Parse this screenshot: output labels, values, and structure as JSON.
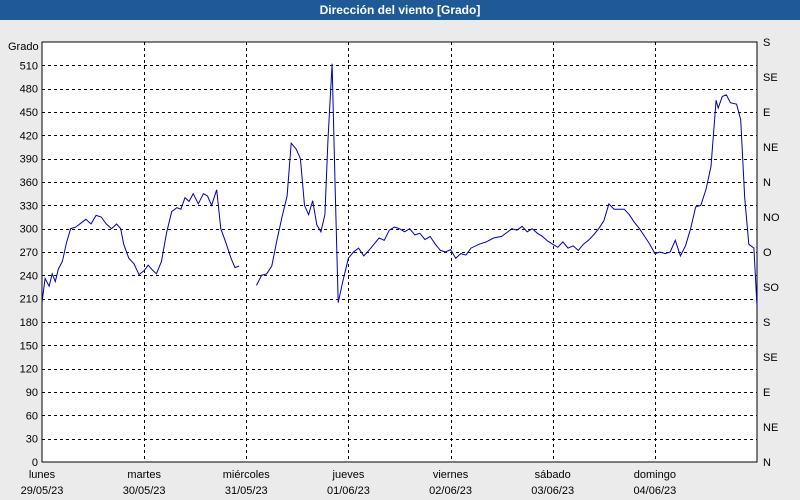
{
  "window": {
    "title": "Dirección del viento [Grado]"
  },
  "colors": {
    "title_bar": "#1f5a96",
    "line": "#0000b4",
    "plot_bg": "#ffffff",
    "window_bg": "#ebebeb",
    "grid": "#000000"
  },
  "chart_data": {
    "type": "line",
    "title": "Dirección del viento [Grado]",
    "ylabel": "Grado",
    "ylim": [
      0,
      540
    ],
    "yticks": [
      0,
      30,
      60,
      90,
      120,
      150,
      180,
      210,
      240,
      270,
      300,
      330,
      360,
      390,
      420,
      450,
      480,
      510
    ],
    "right_axis_ticks": [
      {
        "value": 0,
        "label": "N"
      },
      {
        "value": 45,
        "label": "NE"
      },
      {
        "value": 90,
        "label": "E"
      },
      {
        "value": 135,
        "label": "SE"
      },
      {
        "value": 180,
        "label": "S"
      },
      {
        "value": 225,
        "label": "SO"
      },
      {
        "value": 270,
        "label": "O"
      },
      {
        "value": 315,
        "label": "NO"
      },
      {
        "value": 360,
        "label": "N"
      },
      {
        "value": 405,
        "label": "NE"
      },
      {
        "value": 450,
        "label": "E"
      },
      {
        "value": 495,
        "label": "SE"
      },
      {
        "value": 540,
        "label": "S"
      }
    ],
    "xlim": [
      0,
      7
    ],
    "day_labels": [
      {
        "day": "lunes",
        "date": "29/05/23"
      },
      {
        "day": "martes",
        "date": "30/05/23"
      },
      {
        "day": "miércoles",
        "date": "31/05/23"
      },
      {
        "day": "jueves",
        "date": "01/06/23"
      },
      {
        "day": "viernes",
        "date": "02/06/23"
      },
      {
        "day": "sábado",
        "date": "03/06/23"
      },
      {
        "day": "domingo",
        "date": "04/06/23"
      }
    ],
    "grid": true,
    "series": [
      {
        "segments": [
          [
            [
              0.0,
              205
            ],
            [
              0.03,
              236
            ],
            [
              0.07,
              226
            ],
            [
              0.1,
              242
            ],
            [
              0.13,
              232
            ],
            [
              0.16,
              248
            ],
            [
              0.2,
              258
            ],
            [
              0.24,
              282
            ],
            [
              0.28,
              300
            ],
            [
              0.33,
              302
            ],
            [
              0.38,
              307
            ],
            [
              0.43,
              312
            ],
            [
              0.48,
              306
            ],
            [
              0.53,
              317
            ],
            [
              0.58,
              315
            ],
            [
              0.63,
              306
            ],
            [
              0.68,
              300
            ],
            [
              0.73,
              306
            ],
            [
              0.77,
              300
            ],
            [
              0.8,
              280
            ],
            [
              0.85,
              262
            ],
            [
              0.9,
              255
            ],
            [
              0.95,
              241
            ],
            [
              1.0,
              246
            ],
            [
              1.04,
              253
            ],
            [
              1.08,
              247
            ],
            [
              1.12,
              242
            ],
            [
              1.17,
              258
            ],
            [
              1.22,
              295
            ],
            [
              1.27,
              322
            ],
            [
              1.32,
              327
            ],
            [
              1.36,
              325
            ],
            [
              1.4,
              340
            ],
            [
              1.44,
              335
            ],
            [
              1.48,
              345
            ],
            [
              1.53,
              332
            ],
            [
              1.58,
              345
            ],
            [
              1.62,
              342
            ],
            [
              1.66,
              330
            ],
            [
              1.71,
              350
            ],
            [
              1.75,
              300
            ],
            [
              1.8,
              282
            ],
            [
              1.85,
              262
            ],
            [
              1.89,
              250
            ],
            [
              1.93,
              252
            ]
          ],
          [
            [
              2.1,
              227
            ],
            [
              2.15,
              240
            ],
            [
              2.2,
              242
            ],
            [
              2.25,
              252
            ],
            [
              2.3,
              285
            ],
            [
              2.35,
              315
            ],
            [
              2.4,
              342
            ],
            [
              2.44,
              410
            ],
            [
              2.49,
              402
            ],
            [
              2.53,
              390
            ],
            [
              2.57,
              330
            ],
            [
              2.61,
              318
            ],
            [
              2.65,
              336
            ],
            [
              2.69,
              305
            ],
            [
              2.73,
              296
            ],
            [
              2.77,
              318
            ],
            [
              2.8,
              415
            ],
            [
              2.84,
              512
            ],
            [
              2.87,
              350
            ],
            [
              2.9,
              205
            ],
            [
              2.95,
              235
            ],
            [
              3.0,
              262
            ],
            [
              3.05,
              270
            ],
            [
              3.1,
              275
            ],
            [
              3.15,
              265
            ],
            [
              3.2,
              272
            ],
            [
              3.25,
              280
            ],
            [
              3.3,
              288
            ],
            [
              3.35,
              285
            ],
            [
              3.4,
              298
            ],
            [
              3.45,
              302
            ],
            [
              3.5,
              300
            ],
            [
              3.55,
              296
            ],
            [
              3.6,
              300
            ],
            [
              3.65,
              292
            ],
            [
              3.7,
              294
            ],
            [
              3.75,
              286
            ],
            [
              3.8,
              290
            ],
            [
              3.85,
              280
            ],
            [
              3.9,
              272
            ],
            [
              3.95,
              270
            ],
            [
              4.0,
              273
            ],
            [
              4.05,
              262
            ],
            [
              4.1,
              268
            ],
            [
              4.15,
              266
            ],
            [
              4.2,
              275
            ],
            [
              4.28,
              280
            ],
            [
              4.35,
              283
            ],
            [
              4.42,
              288
            ],
            [
              4.5,
              290
            ],
            [
              4.55,
              295
            ],
            [
              4.6,
              300
            ],
            [
              4.65,
              298
            ],
            [
              4.7,
              303
            ],
            [
              4.75,
              296
            ],
            [
              4.8,
              300
            ],
            [
              4.85,
              294
            ],
            [
              4.9,
              290
            ],
            [
              4.95,
              284
            ],
            [
              5.0,
              280
            ],
            [
              5.05,
              276
            ],
            [
              5.1,
              283
            ],
            [
              5.15,
              275
            ],
            [
              5.2,
              278
            ],
            [
              5.25,
              272
            ],
            [
              5.3,
              280
            ],
            [
              5.35,
              285
            ],
            [
              5.4,
              292
            ],
            [
              5.45,
              300
            ],
            [
              5.5,
              310
            ],
            [
              5.55,
              332
            ],
            [
              5.6,
              325
            ],
            [
              5.65,
              325
            ],
            [
              5.7,
              325
            ],
            [
              5.75,
              318
            ],
            [
              5.8,
              308
            ],
            [
              5.85,
              300
            ],
            [
              5.9,
              290
            ],
            [
              5.95,
              280
            ],
            [
              6.0,
              268
            ],
            [
              6.05,
              270
            ],
            [
              6.1,
              268
            ],
            [
              6.15,
              270
            ],
            [
              6.2,
              285
            ],
            [
              6.25,
              265
            ],
            [
              6.3,
              278
            ],
            [
              6.35,
              300
            ],
            [
              6.4,
              328
            ],
            [
              6.45,
              330
            ],
            [
              6.5,
              350
            ],
            [
              6.55,
              380
            ],
            [
              6.6,
              465
            ],
            [
              6.62,
              455
            ],
            [
              6.66,
              470
            ],
            [
              6.7,
              472
            ],
            [
              6.74,
              462
            ],
            [
              6.8,
              460
            ],
            [
              6.84,
              440
            ],
            [
              6.88,
              340
            ],
            [
              6.92,
              280
            ],
            [
              6.97,
              275
            ],
            [
              7.0,
              200
            ]
          ]
        ]
      }
    ]
  }
}
